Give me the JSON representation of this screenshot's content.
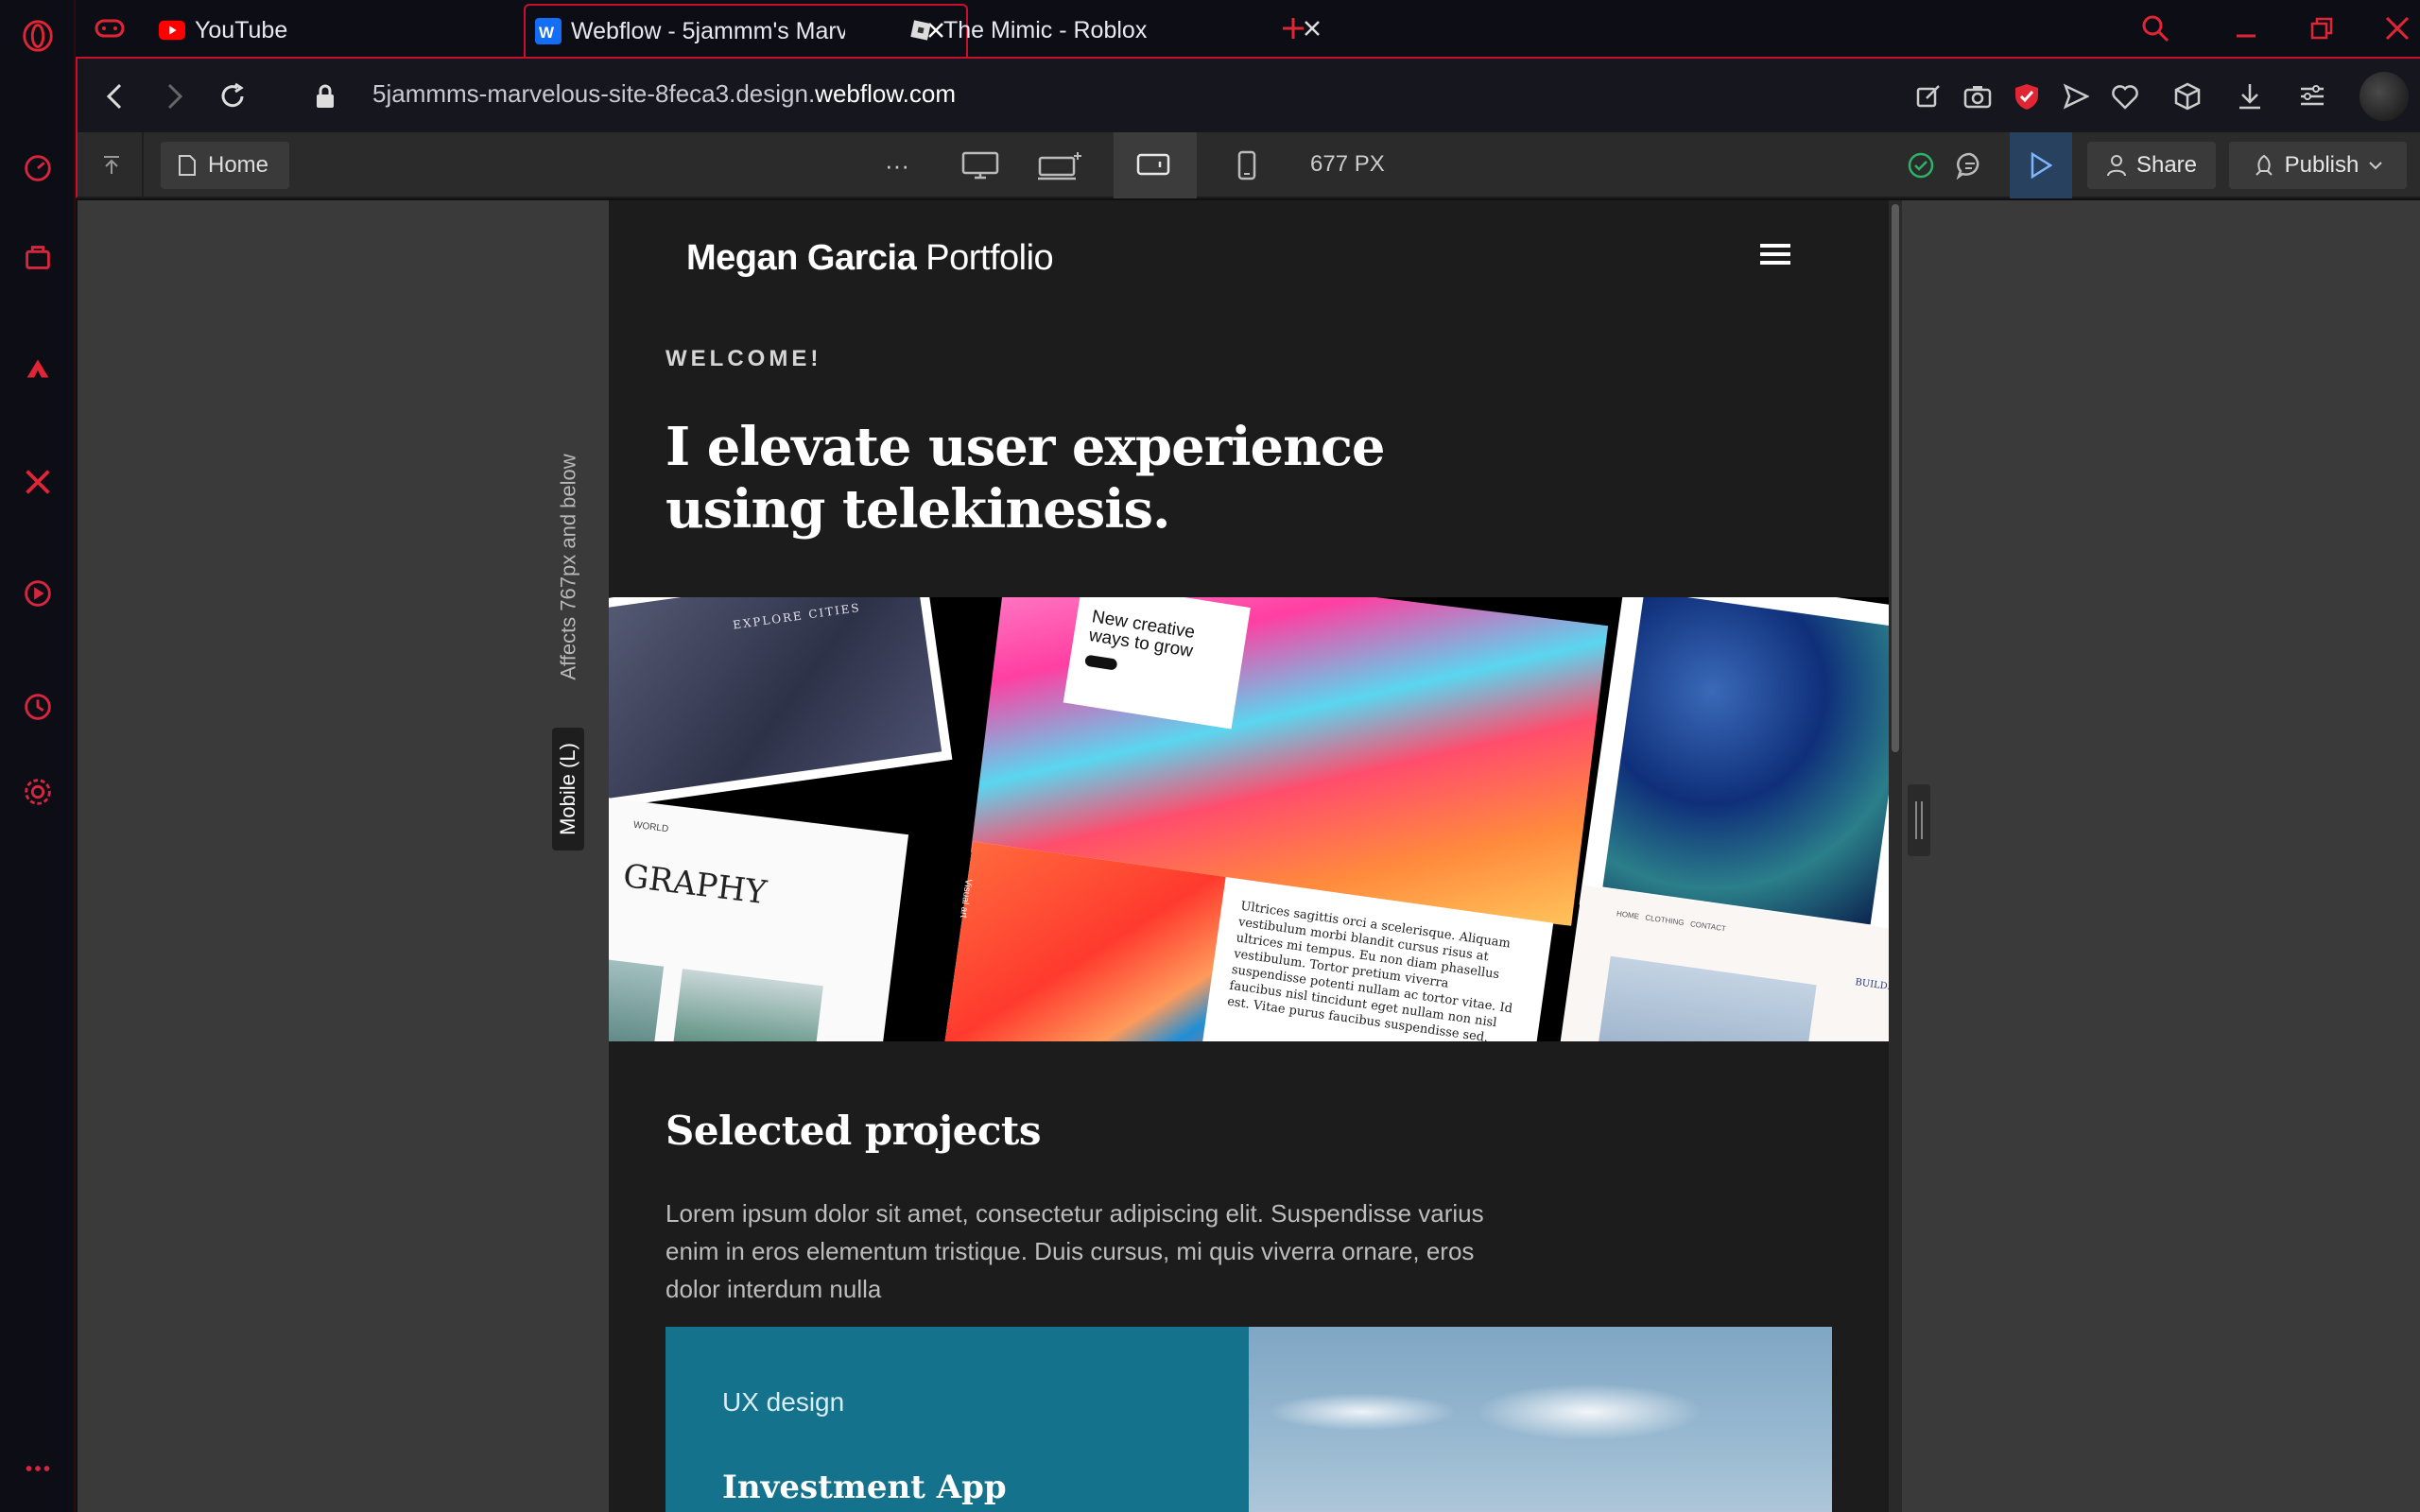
{
  "browser": {
    "tabs": [
      {
        "title": "YouTube",
        "icon": "youtube-icon"
      },
      {
        "title": "Webflow - 5jammm's Marv",
        "icon": "webflow-icon",
        "active": true
      },
      {
        "title": "The Mimic - Roblox",
        "icon": "roblox-icon"
      }
    ],
    "url_prefix": "5jammms-marvelous-site-8feca3.design.",
    "url_domain": "webflow.com"
  },
  "webflow": {
    "page_label": "Home",
    "more": "···",
    "width_readout": "677 PX",
    "share_label": "Share",
    "publish_label": "Publish",
    "breakpoint_note": "Affects 767px and below",
    "breakpoint_name": "Mobile (L)"
  },
  "site": {
    "brand_bold": "Megan Garcia",
    "brand_light": "Portfolio",
    "welcome": "WELCOME!",
    "hero": "I elevate user experience using telekinesis.",
    "mosaic": {
      "tile1_text": "EXPLORE CITIES",
      "tile2_text": "New creative ways to grow",
      "tile4_text": "GRAPHY",
      "tile4_small": "WORLD",
      "tile5_side": "Visual art",
      "tile5_text": "Ultrices sagittis orci a scelerisque. Aliquam vestibulum morbi blandit cursus risus at ultrices mi tempus. Eu non diam phasellus vestibulum. Tortor pretium viverra suspendisse potenti nullam ac tortor vitae. Id faucibus nisl tincidunt eget nullam non nisl est. Vitae purus faucibus suspendisse sed.",
      "tile6_nav": "HOME   CLOTHING   CONTACT",
      "tile6_side": "BUILDINGS"
    },
    "selected_title": "Selected projects",
    "selected_desc": "Lorem ipsum dolor sit amet, consectetur adipiscing elit. Suspendisse varius enim in eros elementum tristique. Duis cursus, mi quis viverra ornare, eros dolor interdum nulla",
    "project": {
      "category": "UX design",
      "name": "Investment App"
    }
  },
  "colors": {
    "accent": "#c8102e",
    "publish_active": "#27415e",
    "card_teal": "#14728c"
  }
}
